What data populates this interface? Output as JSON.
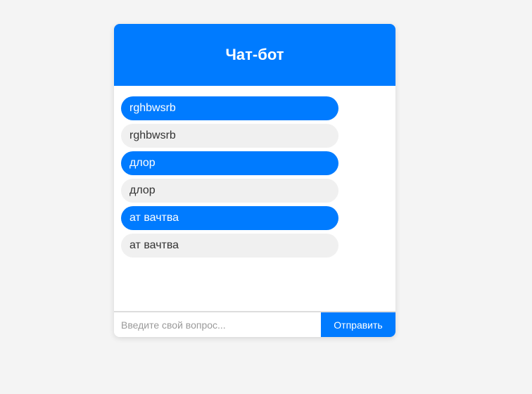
{
  "header": {
    "title": "Чат-бот"
  },
  "messages": [
    {
      "sender": "user",
      "text": "rghbwsrb"
    },
    {
      "sender": "bot",
      "text": "rghbwsrb"
    },
    {
      "sender": "user",
      "text": "длор"
    },
    {
      "sender": "bot",
      "text": "длор"
    },
    {
      "sender": "user",
      "text": "ат вачтва"
    },
    {
      "sender": "bot",
      "text": "ат вачтва"
    }
  ],
  "input": {
    "value": "",
    "placeholder": "Введите свой вопрос..."
  },
  "send_label": "Отправить",
  "colors": {
    "accent": "#007bff",
    "bot_bubble": "#f0f0f0",
    "background": "#f4f4f4"
  }
}
